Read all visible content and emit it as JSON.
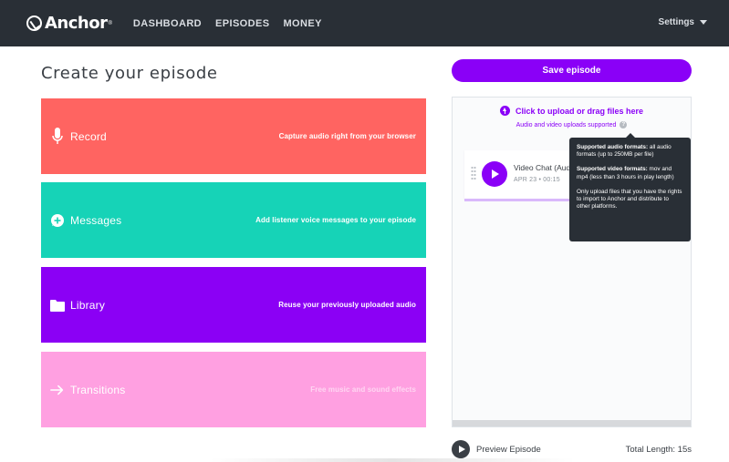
{
  "brand": {
    "name": "Anchor",
    "reg": "®"
  },
  "nav": {
    "items": [
      {
        "label": "DASHBOARD"
      },
      {
        "label": "EPISODES"
      },
      {
        "label": "MONEY"
      }
    ],
    "settings_label": "Settings"
  },
  "page": {
    "title": "Create your episode"
  },
  "cards": {
    "record": {
      "label": "Record",
      "description": "Capture audio right from your browser",
      "icon": "microphone-icon",
      "color": "#ff6461"
    },
    "messages": {
      "label": "Messages",
      "description": "Add listener voice messages to your episode",
      "icon": "message-icon",
      "color": "#16d3b7"
    },
    "library": {
      "label": "Library",
      "description": "Reuse your previously uploaded audio",
      "icon": "folder-icon",
      "color": "#8b00f5"
    },
    "transitions": {
      "label": "Transitions",
      "description": "Free music and sound effects",
      "icon": "arrow-right-icon",
      "color": "#ffa0e1"
    }
  },
  "save_button": {
    "label": "Save episode",
    "color": "#8a00f7"
  },
  "upload": {
    "label": "Click to upload or drag files here",
    "formats_label": "Audio and video uploads supported",
    "icon": "upload-icon"
  },
  "episode": {
    "title": "Video Chat (Aud",
    "meta": "APR 23 • 00:15",
    "progress": 0.5
  },
  "tooltip": {
    "audio_heading": "Supported audio formats:",
    "audio_text": " all audio formats (up to 250MB per file)",
    "video_heading": "Supported video formats:",
    "video_text": " mov and mp4 (less than 3 hours in play length)",
    "rights_text": "Only upload files that you have the rights to import to Anchor and distribute to other platforms."
  },
  "footer": {
    "preview_label": "Preview Episode",
    "total_length": "Total Length: 15s"
  }
}
